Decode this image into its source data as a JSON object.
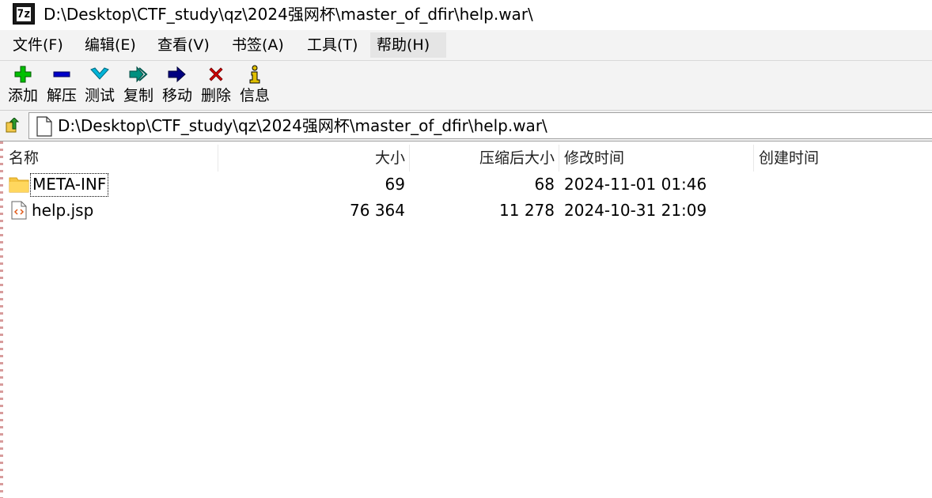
{
  "window": {
    "logo_text": "7z",
    "title": "D:\\Desktop\\CTF_study\\qz\\2024强网杯\\master_of_dfir\\help.war\\"
  },
  "menu": {
    "items": [
      {
        "label": "文件(F)"
      },
      {
        "label": "编辑(E)"
      },
      {
        "label": "查看(V)"
      },
      {
        "label": "书签(A)"
      },
      {
        "label": "工具(T)"
      },
      {
        "label": "帮助(H)"
      }
    ]
  },
  "toolbar": {
    "items": [
      {
        "label": "添加",
        "icon": "plus-icon",
        "color": "#00c000"
      },
      {
        "label": "解压",
        "icon": "minus-icon",
        "color": "#0000c8"
      },
      {
        "label": "测试",
        "icon": "check-chevron-icon",
        "color": "#00b4d8"
      },
      {
        "label": "复制",
        "icon": "double-arrow-icon",
        "color": "#009080"
      },
      {
        "label": "移动",
        "icon": "arrow-right-icon",
        "color": "#000080"
      },
      {
        "label": "删除",
        "icon": "close-icon",
        "color": "#d00000"
      },
      {
        "label": "信息",
        "icon": "info-icon",
        "color": "#e0c000"
      }
    ]
  },
  "address": {
    "path": "D:\\Desktop\\CTF_study\\qz\\2024强网杯\\master_of_dfir\\help.war\\"
  },
  "columns": {
    "name": "名称",
    "size": "大小",
    "packed": "压缩后大小",
    "modified": "修改时间",
    "created": "创建时间"
  },
  "files": [
    {
      "name": "META-INF",
      "size": "69",
      "packed": "68",
      "modified": "2024-11-01 01:46",
      "created": "",
      "icon": "folder-icon"
    },
    {
      "name": "help.jsp",
      "size": "76 364",
      "packed": "11 278",
      "modified": "2024-10-31 21:09",
      "created": "",
      "icon": "code-file-icon"
    }
  ]
}
